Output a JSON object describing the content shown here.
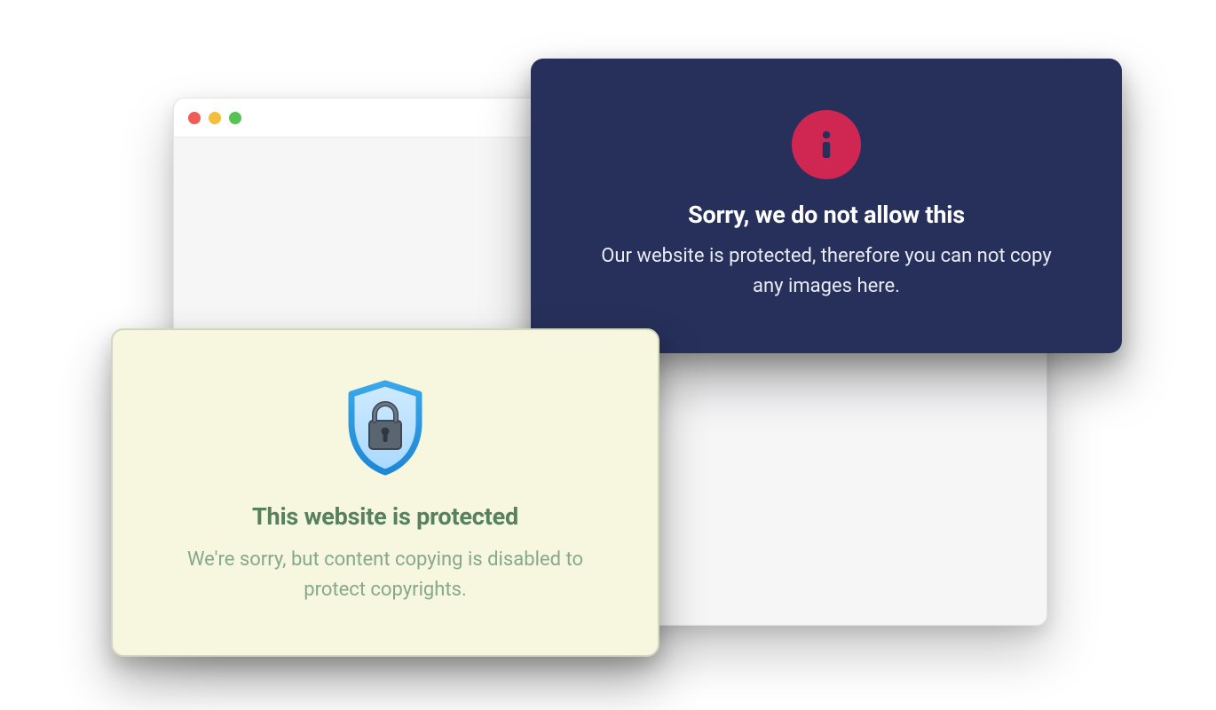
{
  "popupDark": {
    "title": "Sorry, we do not allow this",
    "body": "Our website is protected, therefore you can not copy any images here."
  },
  "popupLight": {
    "title": "This website is protected",
    "body": "We're sorry, but content copying is disabled to protect copyrights."
  }
}
